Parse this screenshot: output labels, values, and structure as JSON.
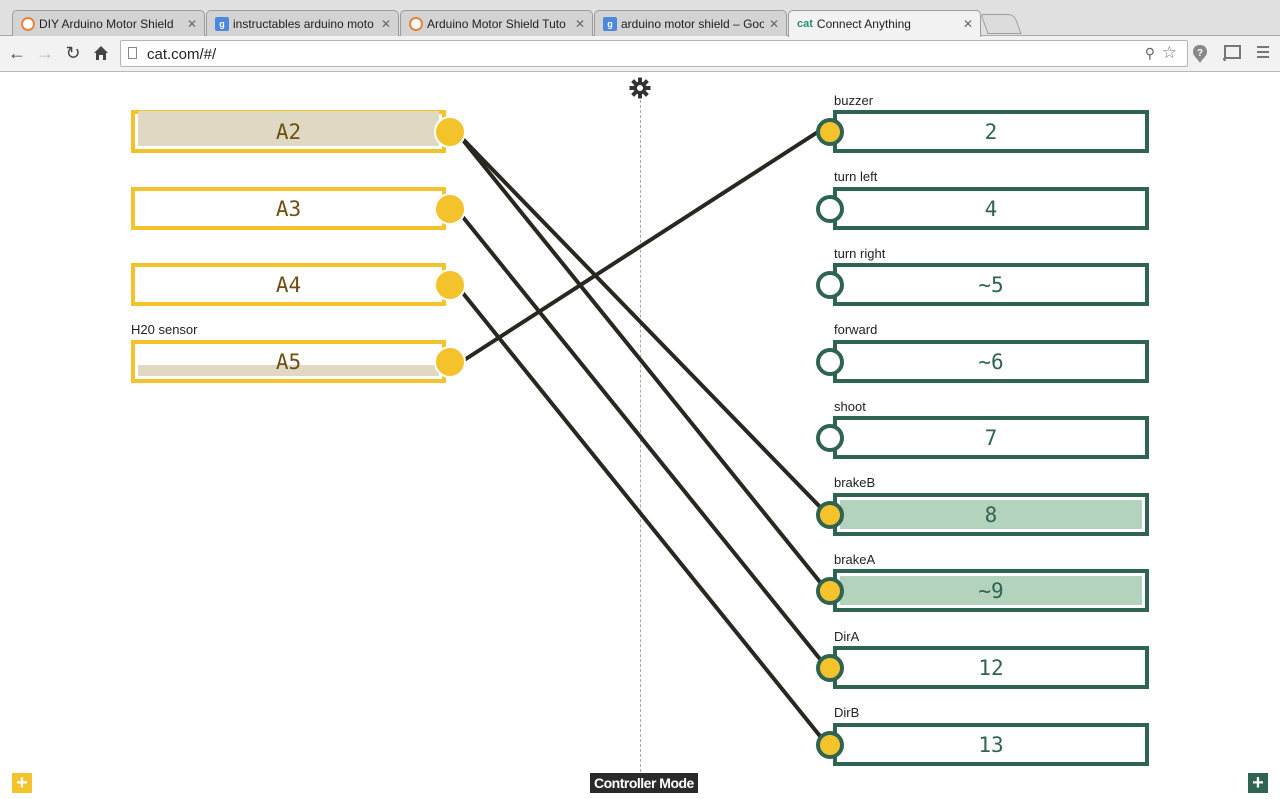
{
  "browser": {
    "tabs": [
      {
        "title": "DIY Arduino Motor Shield",
        "favicon": "instructables-icon",
        "active": false
      },
      {
        "title": "instructables arduino moto",
        "favicon": "google-icon",
        "active": false
      },
      {
        "title": "Arduino Motor Shield Tuto",
        "favicon": "instructables-icon",
        "active": false
      },
      {
        "title": "arduino motor shield – Goo",
        "favicon": "google-icon",
        "active": false
      },
      {
        "title": "Connect Anything",
        "favicon": "cat-icon",
        "favicon_text": "cat",
        "active": true
      }
    ],
    "close_glyph": "✕",
    "url": "cat.com/#/"
  },
  "app": {
    "settings_icon": "gear-icon",
    "mode_label": "Controller Mode",
    "add_glyph": "+",
    "colors": {
      "analog": "#f4c22b",
      "digital": "#2f6352",
      "wire": "#2a2620",
      "digital_active_fill": "#b4d3bd",
      "analog_level_fill": "#dfd9c4"
    },
    "analog_pins": [
      {
        "id": "A2",
        "label": "",
        "level": 1.0
      },
      {
        "id": "A3",
        "label": "",
        "level": 0.0
      },
      {
        "id": "A4",
        "label": "",
        "level": 0.0
      },
      {
        "id": "A5",
        "label": "H20 sensor",
        "level": 0.3
      }
    ],
    "digital_pins": [
      {
        "id": "2",
        "label": "buzzer",
        "active": false,
        "connected": true
      },
      {
        "id": "4",
        "label": "turn left",
        "active": false,
        "connected": false
      },
      {
        "id": "~5",
        "label": "turn right",
        "active": false,
        "connected": false
      },
      {
        "id": "~6",
        "label": "forward",
        "active": false,
        "connected": false
      },
      {
        "id": "7",
        "label": "shoot",
        "active": false,
        "connected": false
      },
      {
        "id": "8",
        "label": "brakeB",
        "active": true,
        "connected": true
      },
      {
        "id": "~9",
        "label": "brakeA",
        "active": true,
        "connected": true
      },
      {
        "id": "12",
        "label": "DirA",
        "active": false,
        "connected": true
      },
      {
        "id": "13",
        "label": "DirB",
        "active": false,
        "connected": true
      }
    ],
    "connections": [
      {
        "from": "A2",
        "to": "8"
      },
      {
        "from": "A2",
        "to": "~9"
      },
      {
        "from": "A3",
        "to": "12"
      },
      {
        "from": "A4",
        "to": "13"
      },
      {
        "from": "A5",
        "to": "2"
      }
    ]
  }
}
